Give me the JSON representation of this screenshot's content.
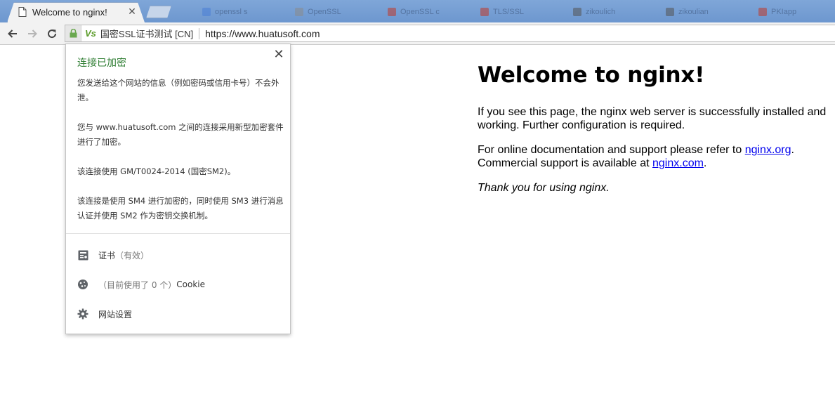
{
  "browser": {
    "active_tab": {
      "title": "Welcome to nginx!",
      "close": "✕"
    },
    "background_tabs": [
      {
        "label": "openssl s",
        "fav_color": "#4a7fd6"
      },
      {
        "label": "OpenSSL",
        "fav_color": "#8a8a8a"
      },
      {
        "label": "OpenSSL c",
        "fav_color": "#c0392b"
      },
      {
        "label": "TLS/SSL",
        "fav_color": "#c0392b"
      },
      {
        "label": "zikoulich",
        "fav_color": "#555555"
      },
      {
        "label": "zikoulian",
        "fav_color": "#555555"
      },
      {
        "label": "PKIapp",
        "fav_color": "#c0392b"
      }
    ]
  },
  "toolbar": {
    "vs_logo": "Vs",
    "site_label": "国密SSL证书测试 [CN]",
    "url": "https://www.huatusoft.com"
  },
  "popup": {
    "close": "✕",
    "title": "连接已加密",
    "paragraphs": [
      "您发送给这个网站的信息（例如密码或信用卡号）不会外泄。",
      "您与 www.huatusoft.com 之间的连接采用新型加密套件进行了加密。",
      "该连接使用 GM/T0024-2014 (国密SM2)。",
      "该连接是使用 SM4 进行加密的，同时使用 SM3 进行消息认证并使用 SM2 作为密钥交换机制。"
    ],
    "cert_label": "证书",
    "cert_status": "（有效）",
    "cookie_count": "（目前使用了 0 个）",
    "cookie_label": "Cookie",
    "site_settings": "网站设置"
  },
  "page": {
    "heading": "Welcome to nginx!",
    "p1": "If you see this page, the nginx web server is successfully installed and working. Further configuration is required.",
    "p2_before": "For online documentation and support please refer to ",
    "link1": "nginx.org",
    "p2_mid": ".",
    "p2_line2": "Commercial support is available at ",
    "link2": "nginx.com",
    "p2_end": ".",
    "thanks": "Thank you for using nginx."
  },
  "colors": {
    "secure_green": "#2e7d32",
    "link_blue": "#0000ee",
    "tabstrip_blue": "#7fa6d8"
  }
}
